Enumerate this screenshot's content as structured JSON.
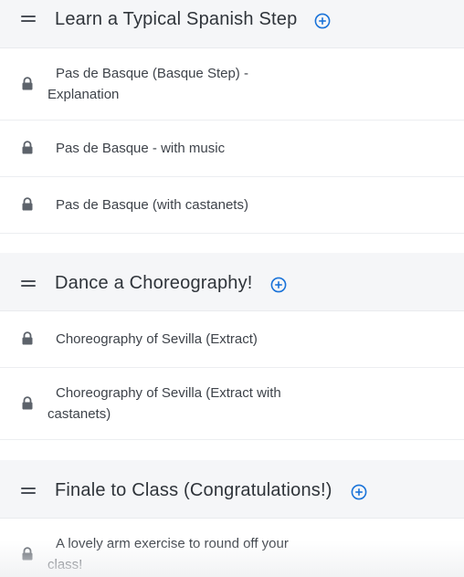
{
  "sections": [
    {
      "title": "Learn a Typical Spanish Step",
      "lessons": [
        "Pas de Basque (Basque Step) - Explanation",
        "Pas de Basque - with music",
        "Pas de Basque (with castanets)"
      ]
    },
    {
      "title": "Dance a Choreography!",
      "lessons": [
        "Choreography of Sevilla (Extract)",
        "Choreography of Sevilla (Extract with castanets)"
      ]
    },
    {
      "title": "Finale to Class (Congratulations!)",
      "lessons": [
        "A lovely arm exercise to round off your class!"
      ]
    }
  ],
  "icons": {
    "drag": "drag-handle-icon",
    "add": "plus-circle-icon",
    "lock": "lock-icon"
  },
  "colors": {
    "accent": "#1a73d9",
    "header_bg": "#f5f6f8",
    "lock": "#5d636b"
  }
}
